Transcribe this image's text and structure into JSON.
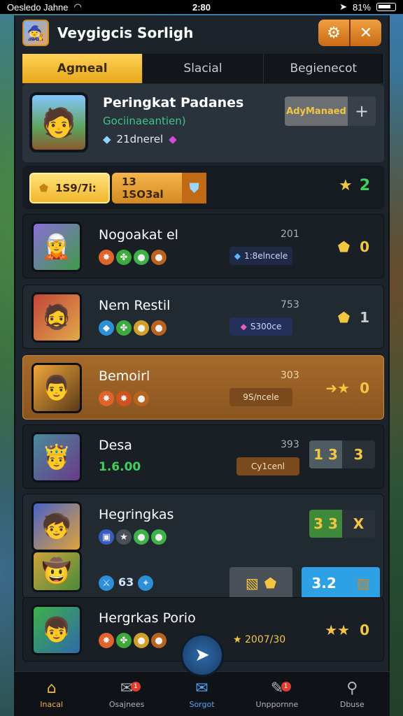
{
  "status": {
    "carrier": "Oesledo Jahne",
    "time": "2:80",
    "battery": "81%"
  },
  "header": {
    "title": "Veygigcis Sorligh"
  },
  "tabs": [
    {
      "label": "Agmeal",
      "active": true
    },
    {
      "label": "Slacial",
      "active": false
    },
    {
      "label": "Begienecot",
      "active": false
    }
  ],
  "profile": {
    "name": "Peringkat Padanes",
    "sub": "Gociinaeantien)",
    "gems": "21dnerel",
    "action_label": "AdyManaed",
    "add": "+"
  },
  "currency": {
    "gold": "1S9/7i:",
    "silver": "13 1SO3al",
    "rank": "2"
  },
  "rows": [
    {
      "name": "Nogoakat el",
      "num": "201",
      "tag": "1:8elncele",
      "score": "0"
    },
    {
      "name": "Nem Restil",
      "num": "753",
      "tag": "S300ce",
      "score": "1"
    },
    {
      "name": "Bemoirl",
      "num": "303",
      "tag": "9S/ncele",
      "score": "0"
    },
    {
      "name": "Desa",
      "num": "393",
      "sub": "1.6.00",
      "tag": "Cy1cenl",
      "box_a": "1 3",
      "box_b": "3"
    },
    {
      "name": "Hegringkas",
      "box_a": "3 3",
      "box_b": "X",
      "extra": "63",
      "bottom_score": "3.2"
    },
    {
      "name": "Hergrkas Porio",
      "num2": "2007/30",
      "score": "0"
    }
  ],
  "nav": [
    {
      "label": "Inacal",
      "icon": "home-icon",
      "active": true
    },
    {
      "label": "Osajnees",
      "icon": "chat-icon",
      "badge": "1"
    },
    {
      "label": "Sorgot",
      "icon": "mail-icon"
    },
    {
      "label": "Unppornne",
      "icon": "message-icon",
      "badge": "1"
    },
    {
      "label": "Dbuse",
      "icon": "search-icon"
    }
  ]
}
